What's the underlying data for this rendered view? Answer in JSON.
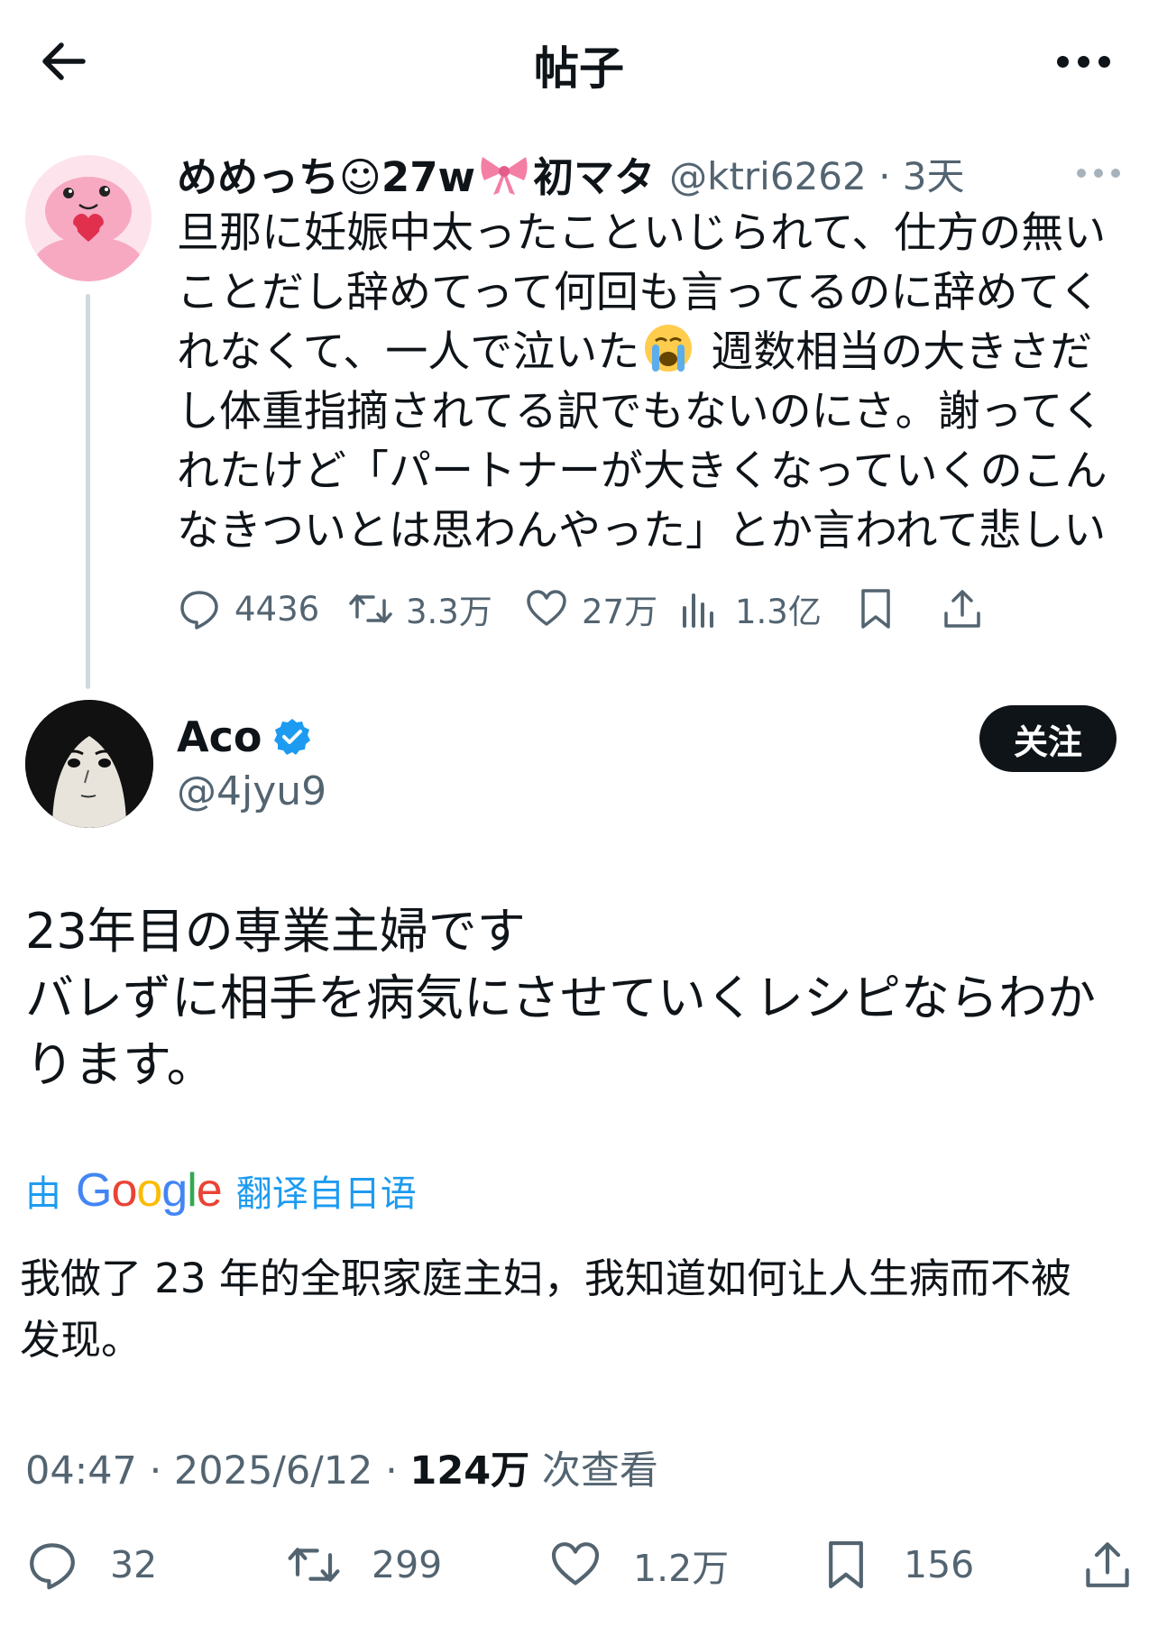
{
  "header": {
    "title": "帖子",
    "back_icon": "arrow-left-icon",
    "more_icon": "more-horizontal-icon"
  },
  "parent_tweet": {
    "name_part1": "めめっち☺27w",
    "name_emoji": "ribbon-icon",
    "name_part2": "初マタ",
    "handle_time": "@ktri6262 · 3天",
    "text_lines": [
      "旦那に妊娠中太ったこといじられて、仕方の無い",
      "ことだし辞めてって何回も言ってるのに辞めてく",
      "れなくて、一人で泣いた",
      " 週数相当の大きさだ",
      "し体重指摘されてる訳でもないのにさ。謝ってく",
      "れたけど「パートナーが大きくなっていくのこん",
      "なきついとは思わんやった」とか言われて悲しい"
    ],
    "stats": {
      "replies": "4436",
      "retweets": "3.3万",
      "likes": "27万",
      "views": "1.3亿"
    }
  },
  "main_tweet": {
    "name": "Aco",
    "handle": "@4jyu9",
    "follow_label": "关注",
    "text_lines": [
      "23年目の専業主婦です",
      "バレずに相手を病気にさせていくレシピならわか",
      "ります。"
    ],
    "translate": {
      "prefix": "由",
      "google": "Google",
      "suffix": "翻译自日语"
    },
    "translation_lines": [
      "我做了 23 年的全职家庭主妇，我知道如何让人生病而不被",
      "发现。"
    ],
    "meta": {
      "time_date": "04:47 · 2025/6/12 · ",
      "views": "124万",
      "views_suffix": " 次查看"
    },
    "stats": {
      "replies": "32",
      "retweets": "299",
      "likes": "1.2万",
      "bookmarks": "156"
    }
  },
  "colors": {
    "text": "#0f1419",
    "secondary": "#536471",
    "link": "#1d9bf0",
    "thread_line": "#cfd9de"
  }
}
